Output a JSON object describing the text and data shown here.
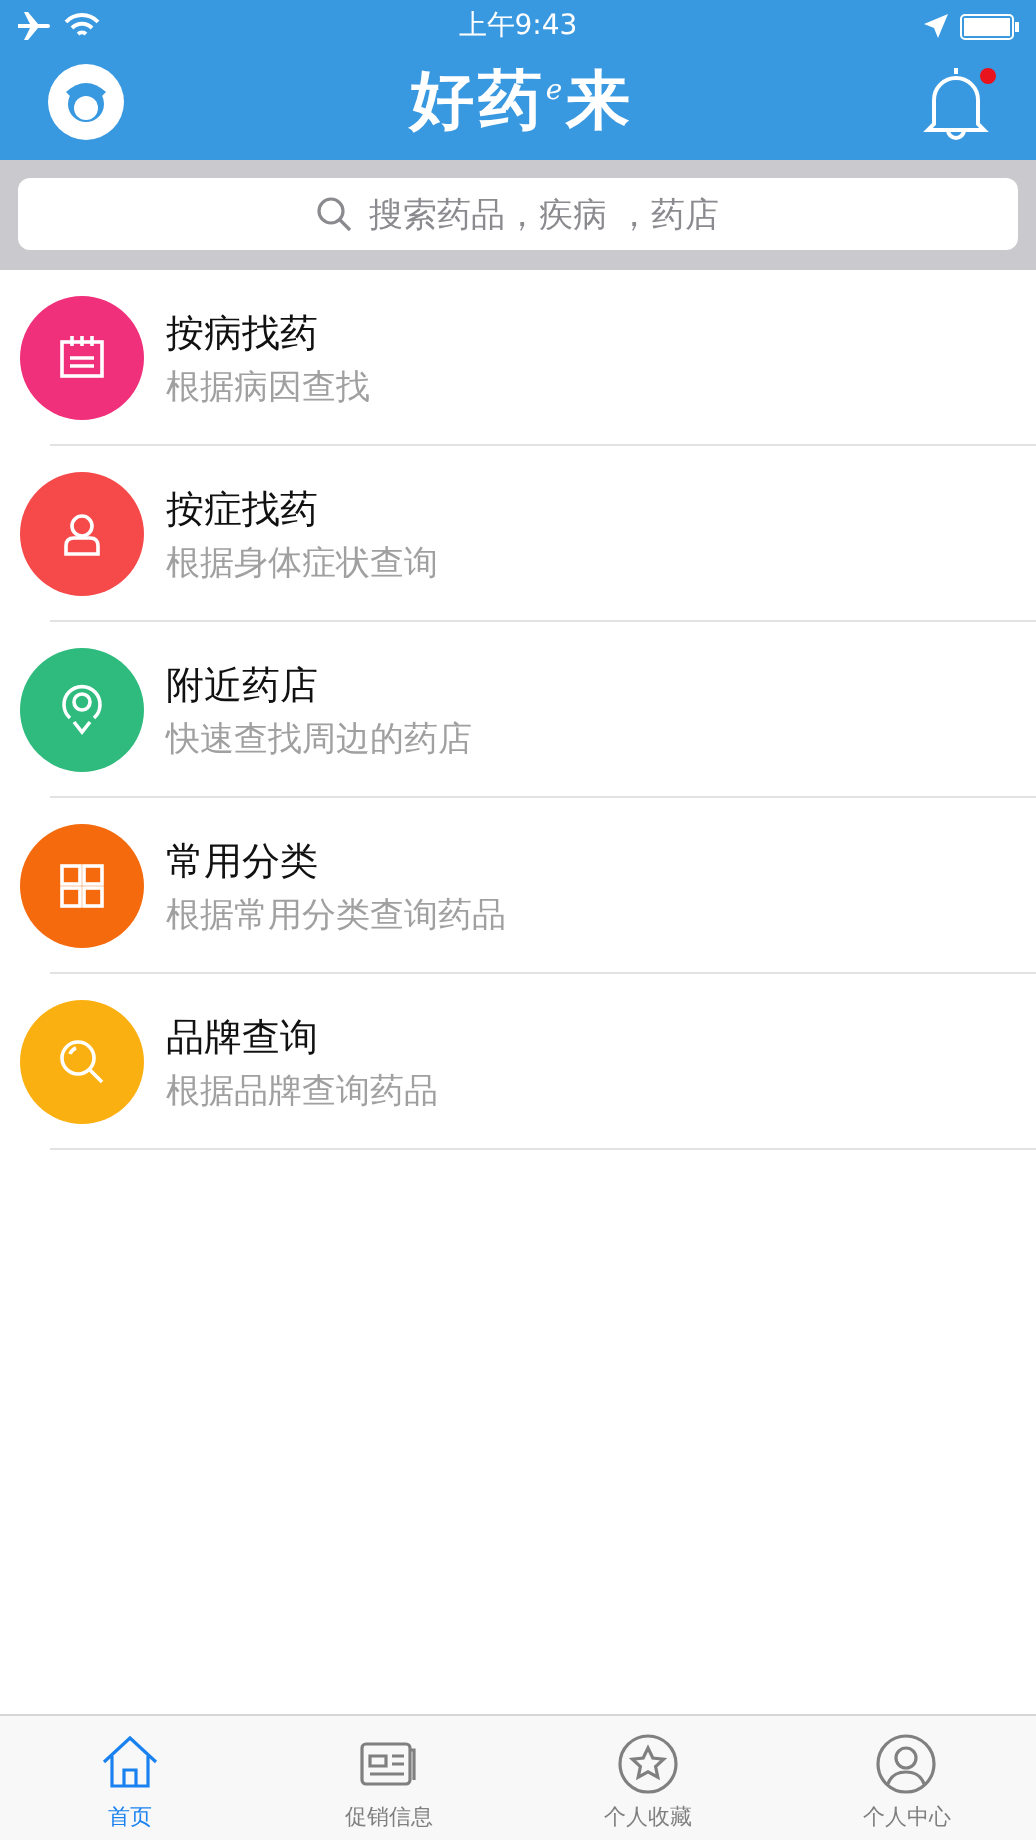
{
  "status_bar": {
    "time": "上午9:43"
  },
  "header": {
    "title": "好药$^{e}$来",
    "notification": true
  },
  "search": {
    "placeholder": "搜索药品，疾病 ，药店"
  },
  "menu": [
    {
      "kind": "calendar",
      "color": "#f0307a",
      "title": "按病找药",
      "subtitle": "根据病因查找"
    },
    {
      "kind": "person",
      "color": "#f64a4a",
      "title": "按症找药",
      "subtitle": "根据身体症状查询"
    },
    {
      "kind": "location",
      "color": "#2fbb7e",
      "title": "附近药店",
      "subtitle": "快速查找周边的药店"
    },
    {
      "kind": "grid",
      "color": "#f46a0c",
      "title": "常用分类",
      "subtitle": "根据常用分类查询药品"
    },
    {
      "kind": "search",
      "color": "#fbb012",
      "title": "品牌查询",
      "subtitle": "根据品牌查询药品"
    }
  ],
  "tab_bar": [
    {
      "kind": "home",
      "label": "首页",
      "selected": true
    },
    {
      "kind": "news",
      "label": "促销信息",
      "selected": false
    },
    {
      "kind": "star",
      "label": "个人收藏",
      "selected": false
    },
    {
      "kind": "user",
      "label": "个人中心",
      "selected": false
    }
  ]
}
